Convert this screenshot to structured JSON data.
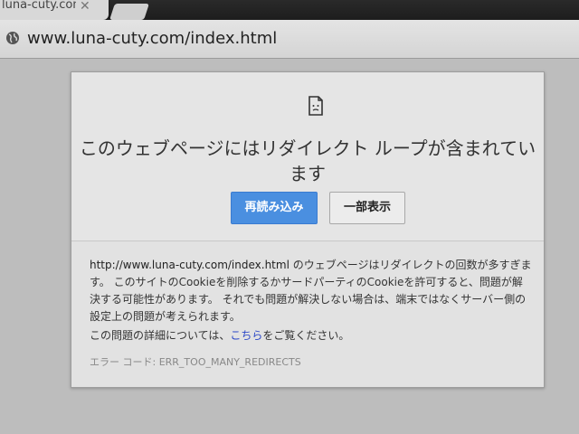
{
  "browser": {
    "tab": {
      "title": "luna-cuty.com",
      "close": "✕"
    },
    "url": "www.luna-cuty.com/index.html"
  },
  "error_page": {
    "title_line1": "このウェブページにはリダイレクト ループが含まれてい",
    "title_line2": "ます",
    "buttons": {
      "reload": "再読み込み",
      "partial": "一部表示"
    },
    "description": {
      "url": "http://www.luna-cuty.com/index.html",
      "text": " のウェブページはリダイレクトの回数が多すぎます。 このサイトのCookieを削除するかサードパーティのCookieを許可すると、問題が解決する可能性があります。 それでも問題が解決しない場合は、端末ではなくサーバー側の設定上の問題が考えられます。"
    },
    "more_info": {
      "prefix": "この問題の詳細については、",
      "link": "こちら",
      "suffix": "をご覧ください。"
    },
    "error_code": "エラー コード: ERR_TOO_MANY_REDIRECTS"
  }
}
